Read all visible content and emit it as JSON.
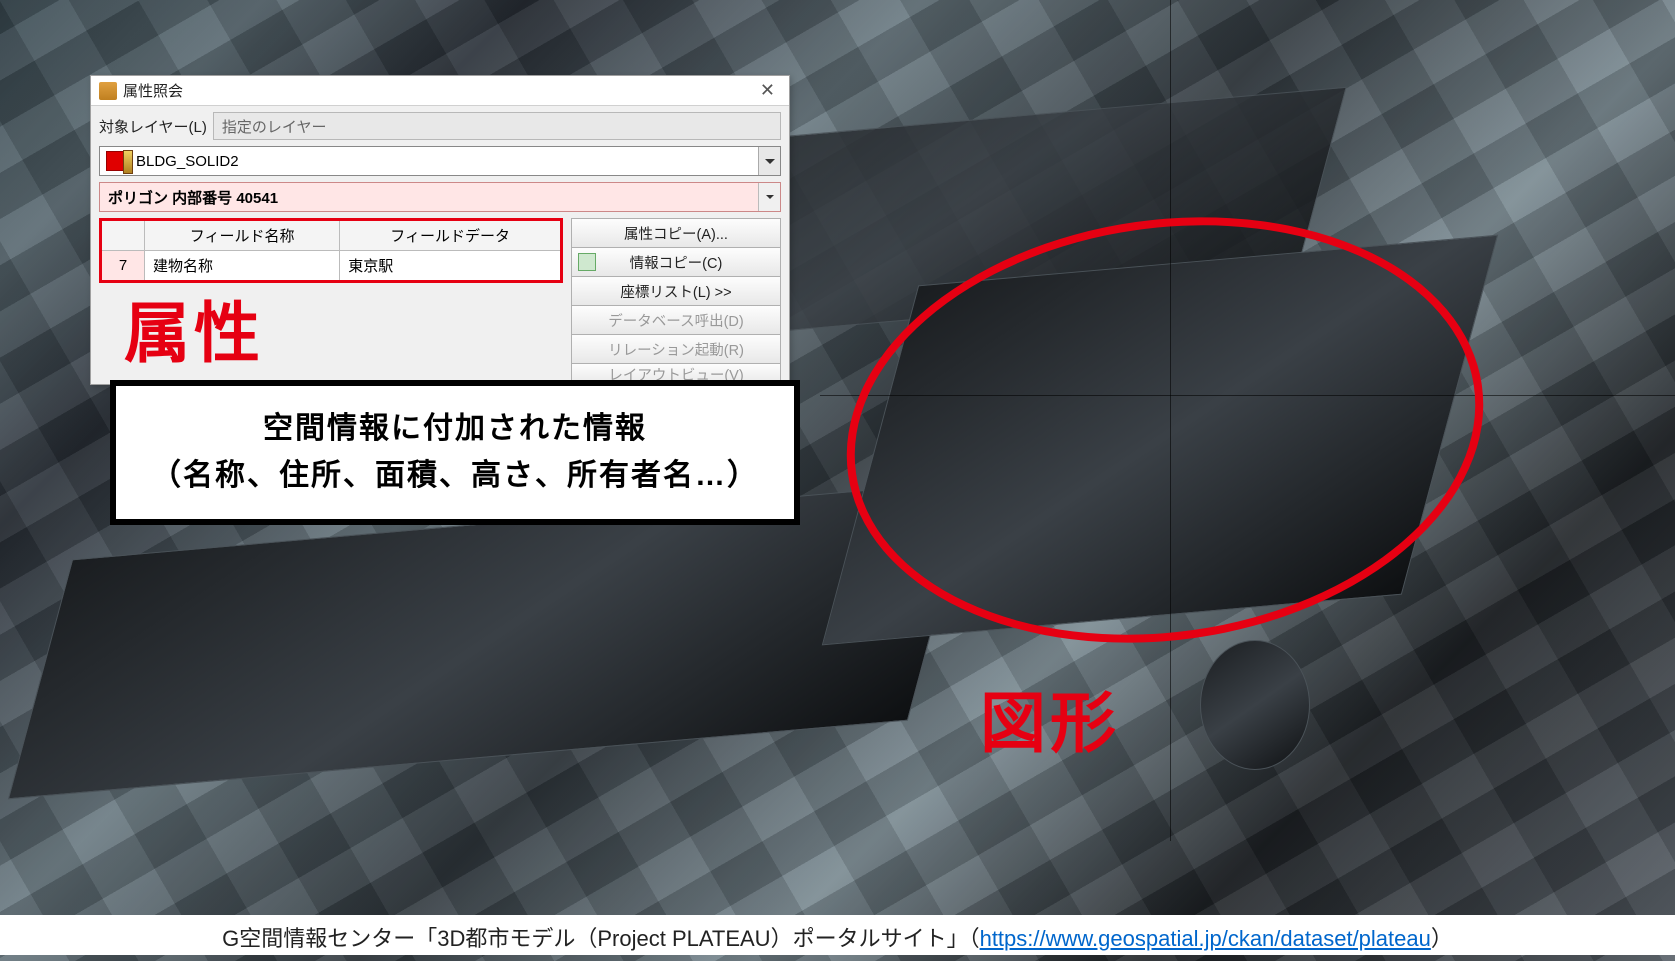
{
  "dialog": {
    "title": "属性照会",
    "target_layer_label": "対象レイヤー(L)",
    "target_layer_placeholder": "指定のレイヤー",
    "layer_name": "BLDG_SOLID2",
    "polygon_label": "ポリゴン 内部番号 40541",
    "table": {
      "headers": {
        "field_name": "フィールド名称",
        "field_data": "フィールドデータ"
      },
      "rows": [
        {
          "index": "7",
          "name": "建物名称",
          "data": "東京駅"
        }
      ]
    },
    "buttons": {
      "copy_attr": "属性コピー(A)...",
      "copy_info": "情報コピー(C)",
      "coord_list": "座標リスト(L) >>",
      "db_call": "データベース呼出(D)",
      "relation": "リレーション起動(R)",
      "layout_view": "レイアウトビュー(V)"
    }
  },
  "annotations": {
    "attribute_label": "属性",
    "shape_label": "図形",
    "caption_line1": "空間情報に付加された情報",
    "caption_line2": "（名称、住所、面積、高さ、所有者名…）"
  },
  "citation": {
    "prefix": "G空間情報センター「3D都市モデル（Project PLATEAU）ポータルサイト」（",
    "link_text": "https://www.geospatial.jp/ckan/dataset/plateau",
    "suffix": "）"
  },
  "icons": {
    "app": "attribute-query-icon",
    "close": "close-icon",
    "layer": "layer-swatch-icon",
    "copy": "copy-icon"
  }
}
